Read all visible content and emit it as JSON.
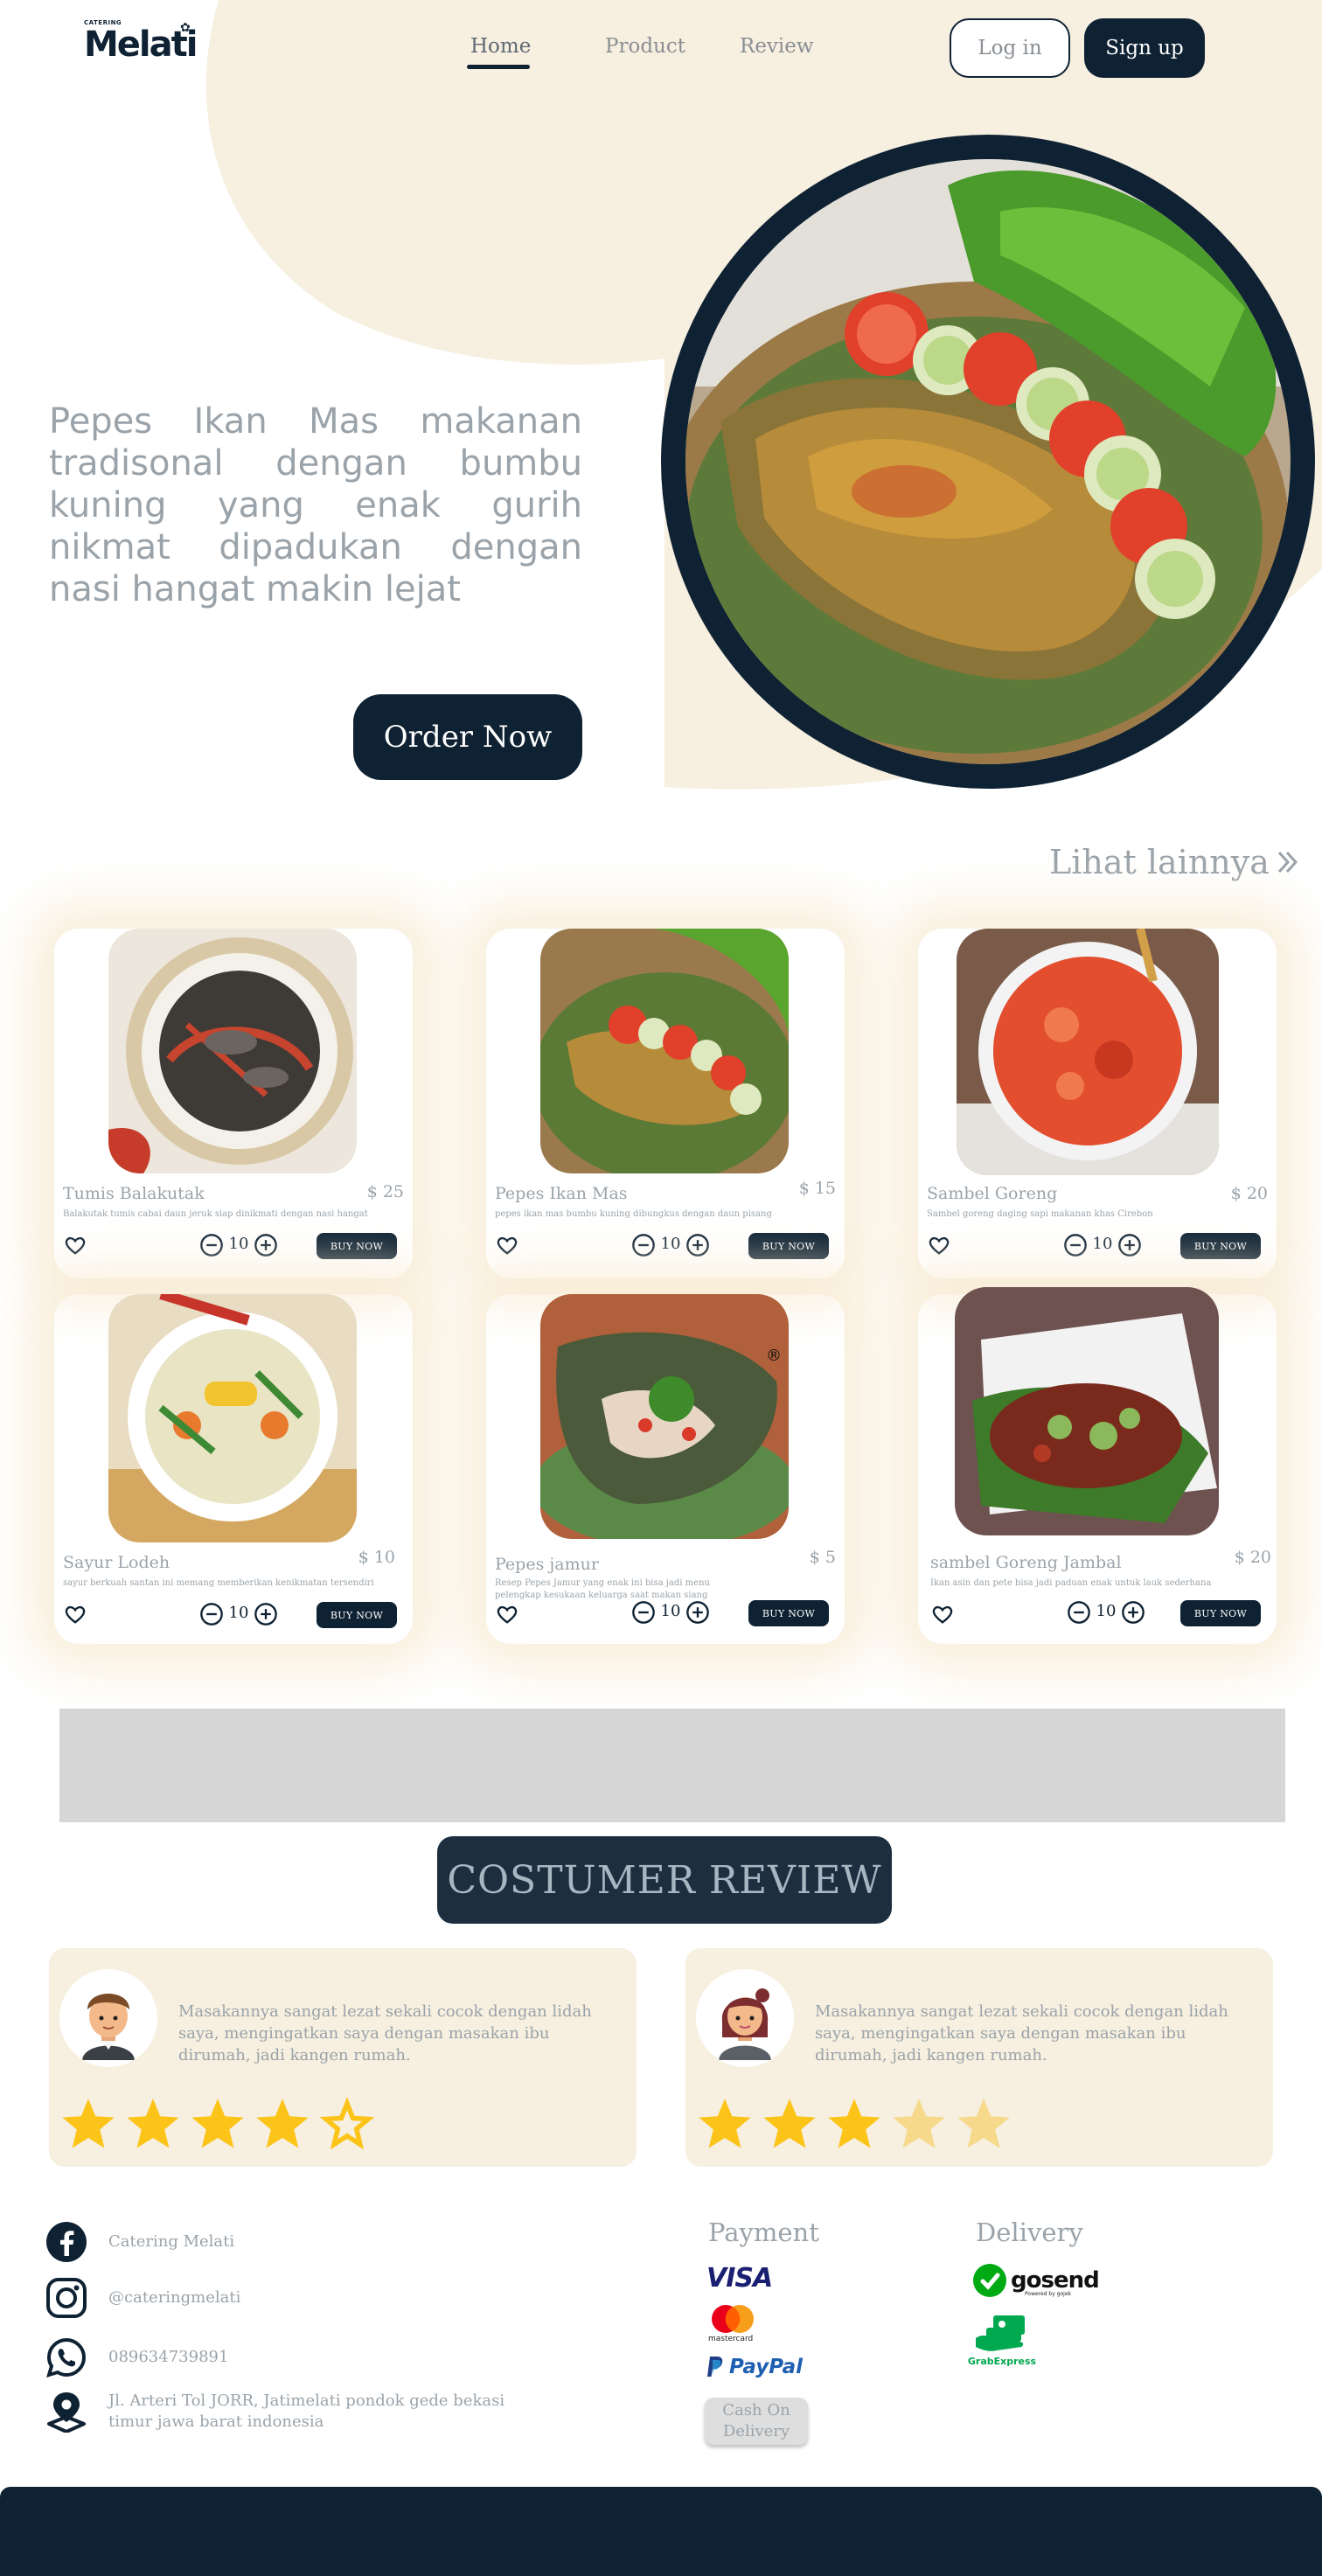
{
  "brand": {
    "tagline": "CATERING",
    "name": "Melati"
  },
  "nav": {
    "items": [
      {
        "label": "Home",
        "active": true
      },
      {
        "label": "Product"
      },
      {
        "label": "Review"
      }
    ],
    "login_label": "Log in",
    "signup_label": "Sign up"
  },
  "hero": {
    "text": "Pepes Ikan Mas makanan tradisonal dengan bumbu kuning yang enak gurih nikmat dipadukan dengan nasi hangat makin lejat",
    "cta_label": "Order Now"
  },
  "products": {
    "see_more_label": "Lihat lainnya",
    "buy_label": "BUY NOW",
    "items": [
      {
        "name": "Tumis Balakutak",
        "price": "$ 25",
        "desc": "Balakutak tumis cabai daun jeruk siap dinikmati dengan nasi hangat",
        "qty": "10"
      },
      {
        "name": "Pepes Ikan Mas",
        "price": "$ 15",
        "desc": "pepes ikan mas bumbu kuning dibungkus dengan daun pisang",
        "qty": "10"
      },
      {
        "name": "Sambel Goreng",
        "price": "$ 20",
        "desc": "Sambel goreng daging sapi makanan khas Cirebon",
        "qty": "10"
      },
      {
        "name": "Sayur Lodeh",
        "price": "$ 10",
        "desc": "sayur berkuah santan ini memang memberikan kenikmatan tersendiri",
        "qty": "10"
      },
      {
        "name": "Pepes jamur",
        "price": "$ 5",
        "desc": "Resep Pepes Jamur yang enak ini bisa jadi menu pelengkap kesukaan keluarga saat makan siang",
        "qty": "10"
      },
      {
        "name": "sambel Goreng Jambal",
        "price": "$ 20",
        "desc": "Ikan asin dan pete bisa jadi paduan enak untuk lauk sederhana",
        "qty": "10"
      }
    ]
  },
  "reviews": {
    "title": "COSTUMER REVIEW",
    "items": [
      {
        "text": "Masakannya sangat lezat sekali  cocok dengan lidah saya, mengingatkan saya dengan masakan ibu dirumah, jadi kangen rumah.",
        "rating": 4,
        "avatar": "male-avatar"
      },
      {
        "text": "Masakannya sangat lezat sekali  cocok dengan lidah saya, mengingatkan saya dengan masakan ibu dirumah, jadi kangen rumah.",
        "rating": 3,
        "avatar": "female-avatar"
      }
    ]
  },
  "footer": {
    "contacts": [
      {
        "icon": "facebook-icon",
        "text": "Catering Melati"
      },
      {
        "icon": "instagram-icon",
        "text": "@cateringmelati"
      },
      {
        "icon": "whatsapp-icon",
        "text": "089634739891"
      },
      {
        "icon": "location-icon",
        "text": "Jl. Arteri Tol JORR, Jatimelati pondok gede bekasi timur jawa barat indonesia"
      }
    ],
    "payment_title": "Payment",
    "payment_methods": {
      "visa": "VISA",
      "mastercard": "mastercard",
      "paypal": "PayPal",
      "cod": "Cash On Delivery"
    },
    "delivery_title": "Delivery",
    "delivery_methods": {
      "gosend": "gosend",
      "gosend_sub": "Powered by gojek",
      "grab": "GrabExpress"
    }
  },
  "colors": {
    "navy": "#0f2233",
    "cream": "#f7efdf",
    "muted_text": "#9aa3aa",
    "star": "#fcc419"
  }
}
